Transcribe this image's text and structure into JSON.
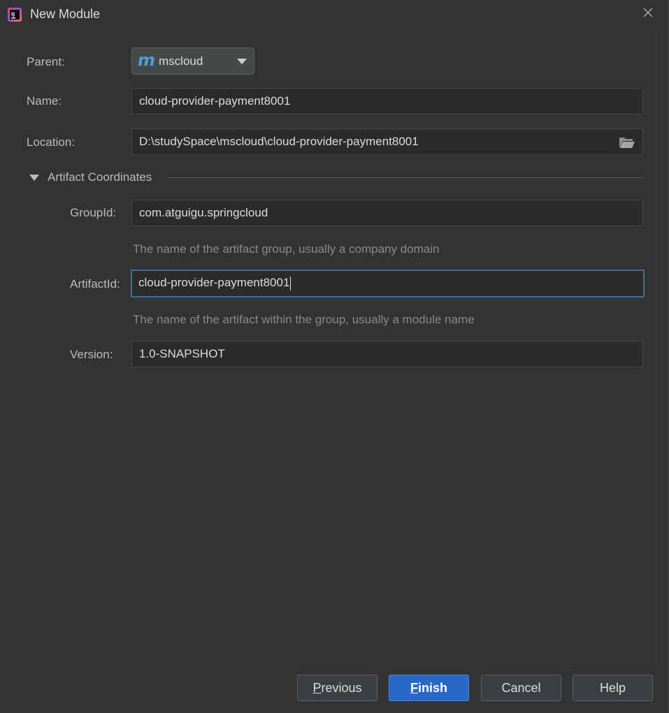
{
  "window": {
    "title": "New Module",
    "app_icon": "intellij-idea-icon",
    "close_icon": "close-icon"
  },
  "form": {
    "parent": {
      "label": "Parent:",
      "value": "mscloud",
      "icon": "maven-icon"
    },
    "name": {
      "label": "Name:",
      "value": "cloud-provider-payment8001"
    },
    "location": {
      "label": "Location:",
      "value": "D:\\studySpace\\mscloud\\cloud-provider-payment8001",
      "icon": "folder-open-icon"
    }
  },
  "artifact": {
    "section_title": "Artifact Coordinates",
    "group_id": {
      "label": "GroupId:",
      "value": "com.atguigu.springcloud",
      "hint": "The name of the artifact group, usually a company domain"
    },
    "artifact_id": {
      "label": "ArtifactId:",
      "value": "cloud-provider-payment8001",
      "hint": "The name of the artifact within the group, usually a module name"
    },
    "version": {
      "label": "Version:",
      "value": "1.0-SNAPSHOT"
    }
  },
  "buttons": {
    "previous": {
      "mnemonic": "P",
      "rest": "revious"
    },
    "finish": {
      "mnemonic": "F",
      "rest": "inish"
    },
    "cancel": "Cancel",
    "help": "Help"
  },
  "colors": {
    "background": "#313335",
    "field_background": "#2b2b2b",
    "focus_border": "#3d6e9c",
    "primary_button": "#2a68c8"
  }
}
